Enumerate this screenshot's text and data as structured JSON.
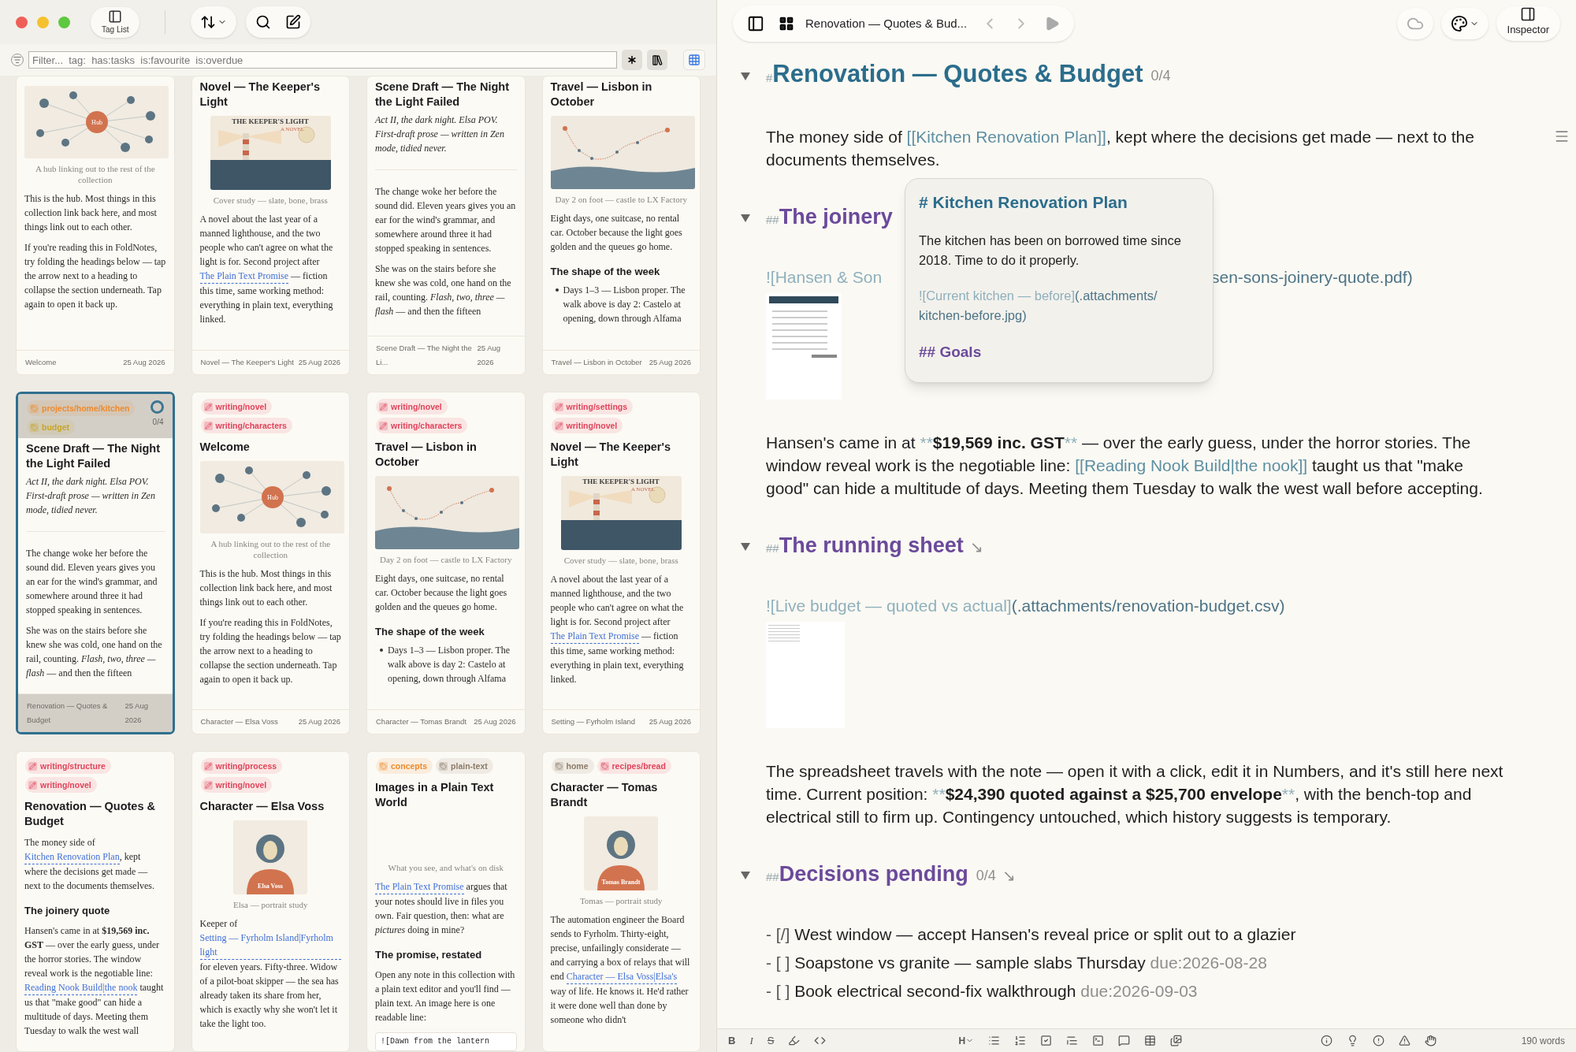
{
  "toolbar": {
    "tag_list": "Tag List"
  },
  "filter": {
    "placeholder": "Filter...  tag:  has:tasks  is:favourite  is:overdue"
  },
  "cards": [
    {
      "selected": false,
      "blocks": [
        {
          "kind": "hub_image",
          "labels": [
            "Hub"
          ],
          "caption": "A hub linking out to the rest of the collection"
        },
        {
          "kind": "para",
          "text": "This is the hub. Most things in this collection link back here, and most things link out to each other."
        },
        {
          "kind": "para",
          "text": "If you're reading this in FoldNotes, try folding the headings below — tap the arrow next to a heading to collapse the section underneath. Tap again to open it back up."
        }
      ],
      "footer": {
        "note": "Welcome",
        "date": "25 Aug 2026"
      }
    },
    {
      "selected": false,
      "title": "Novel — The Keeper's Light",
      "blocks": [
        {
          "kind": "lighthouse_image",
          "labels": [
            "THE KEEPER'S LIGHT",
            "A NOVEL"
          ],
          "caption": "Cover study — slate, bone, brass"
        },
        {
          "kind": "para",
          "runs": [
            {
              "kind": "text",
              "text": "A novel about the last year of a manned lighthouse, and the two people who can't agree on what the light is for. Second project after "
            },
            {
              "kind": "link",
              "text": "The Plain Text Promise"
            },
            {
              "kind": "text",
              "text": " — fiction this time, same working method: everything in plain text, everything linked."
            }
          ]
        }
      ],
      "footer": {
        "note": "Novel — The Keeper's Light",
        "date": "25 Aug 2026"
      }
    },
    {
      "selected": false,
      "title": "Scene Draft — The Night the Light Failed",
      "blocks": [
        {
          "kind": "lead",
          "text": "Act II, the dark night. Elsa POV. First-draft prose — written in Zen mode, tidied never."
        },
        {
          "kind": "rule"
        },
        {
          "kind": "para",
          "text": "The change woke her before the sound did. Eleven years gives you an ear for the wind's grammar, and somewhere around three it had stopped speaking in sentences."
        },
        {
          "kind": "para",
          "text": "She was on the stairs before she knew she was cold, one hand on the rail, counting. *Flash, two, three — flash* — and then the fifteen"
        }
      ],
      "footer": {
        "note": "Scene Draft — The Night the Li...",
        "date": "25 Aug 2026"
      }
    },
    {
      "selected": false,
      "title": "Travel — Lisbon in October",
      "blocks": [
        {
          "kind": "map_image",
          "caption": "Day 2 on foot — castle to LX Factory"
        },
        {
          "kind": "para",
          "text": "Eight days, one suitcase, no rental car. October because the light goes golden and the queues go home."
        },
        {
          "kind": "heading",
          "text": "The shape of the week"
        },
        {
          "kind": "bullet",
          "text": "Days 1–3 — Lisbon proper. The walk above is day 2: Castelo at opening, down through Alfama"
        }
      ],
      "footer": {
        "note": "Travel — Lisbon in October",
        "date": "25 Aug 2026"
      }
    },
    {
      "selected": true,
      "tags": [
        {
          "label": "projects/home/kitchen",
          "kind": "topic",
          "color": "#ee8a2c"
        },
        {
          "label": "budget",
          "kind": "topic",
          "color": "#c9a526"
        }
      ],
      "progress": "0/4",
      "title": "Scene Draft — The Night the Light Failed",
      "blocks": [
        {
          "kind": "lead",
          "text": "Act II, the dark night. Elsa POV. First-draft prose — written in Zen mode, tidied never."
        },
        {
          "kind": "rule"
        },
        {
          "kind": "para",
          "text": "The change woke her before the sound did. Eleven years gives you an ear for the wind's grammar, and somewhere around three it had stopped speaking in sentences."
        },
        {
          "kind": "para",
          "text": "She was on the stairs before she knew she was cold, one hand on the rail, counting. *Flash, two, three — flash* — and then the fifteen"
        }
      ],
      "footer": {
        "note": "Renovation — Quotes & Budget",
        "date": "25 Aug 2026"
      }
    },
    {
      "selected": false,
      "tags": [
        {
          "label": "writing/novel",
          "kind": "writing",
          "color": "#e0435a"
        },
        {
          "label": "writing/characters",
          "kind": "writing",
          "color": "#e0435a"
        }
      ],
      "title": "Welcome",
      "blocks": [
        {
          "kind": "hub_image",
          "labels": [
            "Hub"
          ],
          "caption": "A hub linking out to the rest of the collection"
        },
        {
          "kind": "para",
          "text": "This is the hub. Most things in this collection link back here, and most things link out to each other."
        },
        {
          "kind": "para",
          "text": "If you're reading this in FoldNotes, try folding the headings below — tap the arrow next to a heading to collapse the section underneath. Tap again to open it back up."
        }
      ],
      "footer": {
        "note": "Character — Elsa Voss",
        "date": "25 Aug 2026"
      }
    },
    {
      "selected": false,
      "tags": [
        {
          "label": "writing/novel",
          "kind": "writing",
          "color": "#e0435a"
        },
        {
          "label": "writing/characters",
          "kind": "writing",
          "color": "#e0435a"
        }
      ],
      "title": "Travel — Lisbon in October",
      "blocks": [
        {
          "kind": "map_image",
          "caption": "Day 2 on foot — castle to LX Factory"
        },
        {
          "kind": "para",
          "text": "Eight days, one suitcase, no rental car. October because the light goes golden and the queues go home."
        },
        {
          "kind": "heading",
          "text": "The shape of the week"
        },
        {
          "kind": "bullet",
          "text": "Days 1–3 — Lisbon proper. The walk above is day 2: Castelo at opening, down through Alfama"
        }
      ],
      "footer": {
        "note": "Character — Tomas Brandt",
        "date": "25 Aug 2026"
      }
    },
    {
      "selected": false,
      "tags": [
        {
          "label": "writing/settings",
          "kind": "writing",
          "color": "#e0435a"
        },
        {
          "label": "writing/novel",
          "kind": "writing",
          "color": "#e0435a"
        }
      ],
      "title": "Novel — The Keeper's Light",
      "blocks": [
        {
          "kind": "lighthouse_image",
          "labels": [
            "THE KEEPER'S LIGHT",
            "A NOVEL"
          ],
          "caption": "Cover study — slate, bone, brass"
        },
        {
          "kind": "para",
          "runs": [
            {
              "kind": "text",
              "text": "A novel about the last year of a manned lighthouse, and the two people who can't agree on what the light is for. Second project after "
            },
            {
              "kind": "link",
              "text": "The Plain Text Promise"
            },
            {
              "kind": "text",
              "text": " — fiction this time, same working method: everything in plain text, everything linked."
            }
          ]
        }
      ],
      "footer": {
        "note": "Setting — Fyrholm Island",
        "date": "25 Aug 2026"
      }
    },
    {
      "selected": false,
      "tags": [
        {
          "label": "writing/structure",
          "kind": "writing",
          "color": "#e0435a"
        },
        {
          "label": "writing/novel",
          "kind": "writing",
          "color": "#e0435a"
        }
      ],
      "title": "Renovation — Quotes & Budget",
      "blocks": [
        {
          "kind": "para",
          "runs": [
            {
              "kind": "text",
              "text": "The money side of "
            },
            {
              "kind": "link",
              "text": "Kitchen Renovation Plan"
            },
            {
              "kind": "text",
              "text": ", kept where the decisions get made — next to the documents themselves."
            }
          ]
        },
        {
          "kind": "heading",
          "text": "The joinery quote"
        },
        {
          "kind": "para",
          "runs": [
            {
              "kind": "text",
              "text": "Hansen's came in at **$19,569 inc. GST** — over the early guess, under the horror stories. The window reveal work is the negotiable line: "
            },
            {
              "kind": "link",
              "text": "Reading Nook Build|the nook"
            },
            {
              "kind": "text",
              "text": " taught us that \"make good\" can hide a multitude of days. Meeting them Tuesday to walk the west wall"
            }
          ]
        }
      ]
    },
    {
      "selected": false,
      "tags": [
        {
          "label": "writing/process",
          "kind": "writing",
          "color": "#e0435a"
        },
        {
          "label": "writing/novel",
          "kind": "writing",
          "color": "#e0435a"
        }
      ],
      "title": "Character — Elsa Voss",
      "blocks": [
        {
          "kind": "portrait_image",
          "labels": [
            "Elsa Voss"
          ],
          "caption": "Elsa — portrait study"
        },
        {
          "kind": "para",
          "runs": [
            {
              "kind": "text",
              "text": "Keeper of "
            },
            {
              "kind": "link",
              "text": "Setting — Fyrholm Island|Fyrholm light"
            },
            {
              "kind": "text",
              "text": " for eleven years. Fifty-three. Widow of a pilot-boat skipper — the sea has already taken its share from her, which is exactly why she won't let it take the light too."
            }
          ]
        }
      ]
    },
    {
      "selected": false,
      "tags": [
        {
          "label": "concepts",
          "kind": "topic",
          "color": "#ee8a2c"
        },
        {
          "label": "plain-text",
          "kind": "topic",
          "color": "#8c7a66"
        }
      ],
      "title": "Images in a Plain Text World",
      "blocks": [
        {
          "kind": "blank_image",
          "caption": "What you see, and what's on disk"
        },
        {
          "kind": "para",
          "runs": [
            {
              "kind": "link",
              "text": "The Plain Text Promise"
            },
            {
              "kind": "text",
              "text": " argues that your notes should live in files you own. Fair question, then: what are *pictures* doing in mine?"
            }
          ]
        },
        {
          "kind": "heading",
          "text": "The promise, restated"
        },
        {
          "kind": "para",
          "text": "Open any note in this collection with a plain text editor and you'll find — plain text. An image here is one readable line:"
        },
        {
          "kind": "code",
          "text": "![Dawn from the lantern"
        }
      ]
    },
    {
      "selected": false,
      "tags": [
        {
          "label": "home",
          "kind": "topic",
          "color": "#8c7a66"
        },
        {
          "label": "recipes/bread",
          "kind": "topic",
          "color": "#e0435a"
        }
      ],
      "title": "Character — Tomas Brandt",
      "blocks": [
        {
          "kind": "portrait_image",
          "labels": [
            "Tomas Brandt"
          ],
          "caption": "Tomas — portrait study"
        },
        {
          "kind": "para",
          "runs": [
            {
              "kind": "text",
              "text": "The automation engineer the Board sends to Fyrholm. Thirty-eight, precise, unfailingly considerate — and carrying a box of relays that will end "
            },
            {
              "kind": "link",
              "text": "Character — Elsa Voss|Elsa's"
            },
            {
              "kind": "text",
              "text": " way of life. He knows it. He'd rather it were done well than done by someone who didn't"
            }
          ]
        }
      ]
    }
  ],
  "editor": {
    "title": "Renovation — Quotes & Bud...",
    "inspector": "Inspector",
    "blocks": [
      {
        "kind": "h1",
        "marker": "#",
        "text": "Renovation — Quotes & Budget",
        "count": "0/4",
        "expanded": true
      },
      {
        "kind": "para",
        "focused": true,
        "runs": [
          {
            "kind": "text",
            "text": "The money side of "
          },
          {
            "kind": "link",
            "text": "[[Kitchen Renovation Plan]]"
          },
          {
            "kind": "text",
            "text": ", kept where the decisions get made — next to the documents themselves."
          }
        ]
      },
      {
        "kind": "h2",
        "marker": "##",
        "text": "The joinery",
        "expanded": true
      },
      {
        "kind": "covered_pdf_embed",
        "alt": "![Hansen & Son",
        "path": "sen-sons-joinery-quote.pdf)"
      },
      {
        "kind": "para",
        "focused": false,
        "runs": [
          {
            "kind": "text",
            "text": "Hansen's came in at "
          },
          {
            "kind": "marker",
            "text": "**"
          },
          {
            "kind": "bold",
            "text": "$19,569 inc. GST"
          },
          {
            "kind": "marker",
            "text": "**"
          },
          {
            "kind": "text",
            "text": " — over the early guess, under the horror stories. The window reveal work is the negotiable line: "
          },
          {
            "kind": "link",
            "text": "[[Reading Nook Build|the nook]]"
          },
          {
            "kind": "text",
            "text": " taught us that \"make good\" can hide a multitude of days. Meeting them Tuesday to walk the west wall before accepting."
          }
        ]
      },
      {
        "kind": "h2",
        "marker": "##",
        "text": "The running sheet",
        "jump": "↘",
        "expanded": true
      },
      {
        "kind": "sheet_embed",
        "alt": "![Live budget — quoted vs actual]",
        "path": "(.attachments/renovation-budget.csv)"
      },
      {
        "kind": "para",
        "focused": false,
        "runs": [
          {
            "kind": "text",
            "text": "The spreadsheet travels with the note — open it with a click, edit it in Numbers, and it's still here next time. Current position: "
          },
          {
            "kind": "marker",
            "text": "**"
          },
          {
            "kind": "bold",
            "text": "$24,390 quoted against a $25,700 envelope"
          },
          {
            "kind": "marker",
            "text": "**"
          },
          {
            "kind": "text",
            "text": ", with the bench-top and electrical still to firm up. Contingency untouched, which history suggests is temporary."
          }
        ]
      },
      {
        "kind": "h2",
        "marker": "##",
        "text": "Decisions pending",
        "count": "0/4",
        "jump": "↘",
        "expanded": true
      },
      {
        "kind": "tasks",
        "items": [
          {
            "box": "- [/]",
            "text": "West window — accept Hansen's reveal price or split out to a glazier"
          },
          {
            "box": "- [ ]",
            "text": "Soapstone vs granite — sample slabs Thursday",
            "due": "due:2026-08-28"
          },
          {
            "box": "- [ ]",
            "text": "Book electrical second-fix walkthrough",
            "due": "due:2026-09-03"
          }
        ]
      }
    ],
    "popover": {
      "title": "# Kitchen Renovation Plan",
      "text": "The kitchen has been on borrowed time since 2018. Time to do it properly.",
      "alt": "![Current kitchen — before]",
      "path": "(.attachments/ kitchen-before.jpg)",
      "heading": "## Goals"
    },
    "format_bar": {
      "bold": "B",
      "italic": "I",
      "strike": "S",
      "heading": "H",
      "words": "190 words"
    }
  }
}
